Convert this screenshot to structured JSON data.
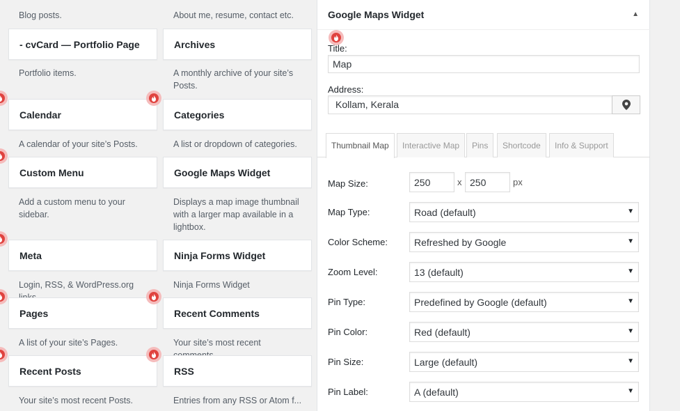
{
  "widgets": {
    "top_desc_left": "Blog posts.",
    "top_desc_right": "About me, resume, contact etc.",
    "rows": [
      {
        "left": {
          "title": "- cvCard — Portfolio Page",
          "desc": "Portfolio items."
        },
        "right": {
          "title": "Archives",
          "desc": "A monthly archive of your site’s Posts."
        }
      },
      {
        "left": {
          "title": "Calendar",
          "desc": "A calendar of your site’s Posts."
        },
        "right": {
          "title": "Categories",
          "desc": "A list or dropdown of categories."
        }
      },
      {
        "left": {
          "title": "Custom Menu",
          "desc": "Add a custom menu to your sidebar."
        },
        "right": {
          "title": "Google Maps Widget",
          "desc": "Displays a map image thumbnail with a larger map available in a lightbox."
        }
      },
      {
        "left": {
          "title": "Meta",
          "desc": "Login, RSS, & WordPress.org links."
        },
        "right": {
          "title": "Ninja Forms Widget",
          "desc": "Ninja Forms Widget"
        }
      },
      {
        "left": {
          "title": "Pages",
          "desc": "A list of your site’s Pages."
        },
        "right": {
          "title": "Recent Comments",
          "desc": "Your site’s most recent comments."
        }
      },
      {
        "left": {
          "title": "Recent Posts",
          "desc": "Your site’s most recent Posts."
        },
        "right": {
          "title": "RSS",
          "desc": "Entries from any RSS or Atom f..."
        }
      }
    ]
  },
  "panel": {
    "title": "Google Maps Widget",
    "collapse_icon": "triangle-up-icon",
    "title_label": "Title:",
    "title_value": "Map",
    "address_label": "Address:",
    "address_value": "Kollam, Kerala",
    "pin_icon": "map-pin-icon",
    "tabs": [
      "Thumbnail Map",
      "Interactive Map",
      "Pins",
      "Shortcode",
      "Info & Support"
    ],
    "active_tab": "Thumbnail Map",
    "map_size": {
      "label": "Map Size:",
      "width": "250",
      "sep": "x",
      "height": "250",
      "unit": "px"
    },
    "selects": [
      {
        "label": "Map Type:",
        "value": "Road (default)"
      },
      {
        "label": "Color Scheme:",
        "value": "Refreshed by Google"
      },
      {
        "label": "Zoom Level:",
        "value": "13 (default)"
      },
      {
        "label": "Pin Type:",
        "value": "Predefined by Google (default)"
      },
      {
        "label": "Pin Color:",
        "value": "Red (default)"
      },
      {
        "label": "Pin Size:",
        "value": "Large (default)"
      },
      {
        "label": "Pin Label:",
        "value": "A (default)"
      }
    ]
  },
  "colors": {
    "accent": "#e0433f",
    "text": "#23282d",
    "muted": "#555d66"
  }
}
